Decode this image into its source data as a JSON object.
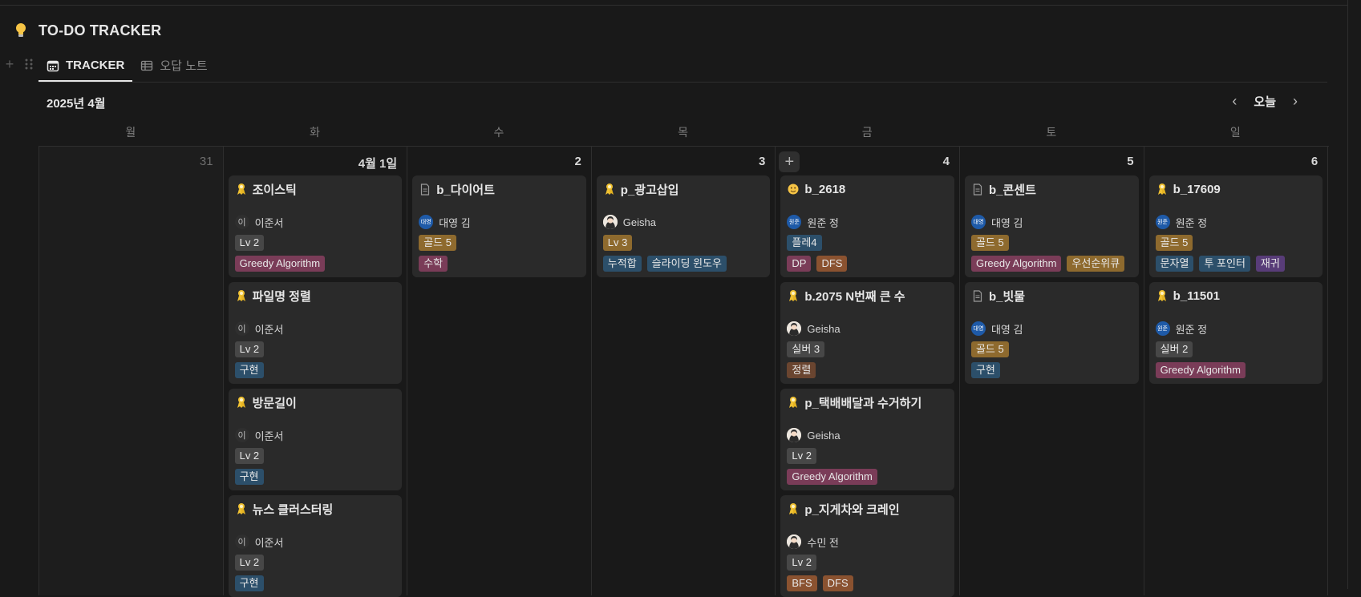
{
  "page": {
    "title": "TO-DO TRACKER",
    "icon": "lightbulb-icon"
  },
  "tabs": [
    {
      "label": "TRACKER",
      "icon": "calendar-icon",
      "active": true
    },
    {
      "label": "오답 노트",
      "icon": "table-icon",
      "active": false
    }
  ],
  "calendar": {
    "month_label": "2025년 4월",
    "today_label": "오늘",
    "weekdays": [
      "월",
      "화",
      "수",
      "목",
      "금",
      "토",
      "일"
    ],
    "days": [
      {
        "label": "31",
        "cards": []
      },
      {
        "label": "4월 1일",
        "cards": [
          {
            "icon": "ribbon",
            "title": "조이스틱",
            "person": {
              "name": "이준서",
              "avatar": "이",
              "style": "letter"
            },
            "rows": [
              [
                {
                  "text": "Lv 2",
                  "color": "gray"
                }
              ],
              [
                {
                  "text": "Greedy Algorithm",
                  "color": "pink"
                }
              ]
            ]
          },
          {
            "icon": "ribbon",
            "title": "파일명 정렬",
            "person": {
              "name": "이준서",
              "avatar": "이",
              "style": "letter"
            },
            "rows": [
              [
                {
                  "text": "Lv 2",
                  "color": "gray"
                }
              ],
              [
                {
                  "text": "구현",
                  "color": "blue"
                }
              ]
            ]
          },
          {
            "icon": "ribbon",
            "title": "방문길이",
            "person": {
              "name": "이준서",
              "avatar": "이",
              "style": "letter"
            },
            "rows": [
              [
                {
                  "text": "Lv 2",
                  "color": "gray"
                }
              ],
              [
                {
                  "text": "구현",
                  "color": "blue"
                }
              ]
            ]
          },
          {
            "icon": "ribbon",
            "title": "뉴스 클러스터링",
            "person": {
              "name": "이준서",
              "avatar": "이",
              "style": "letter"
            },
            "rows": [
              [
                {
                  "text": "Lv 2",
                  "color": "gray"
                }
              ],
              [
                {
                  "text": "구현",
                  "color": "blue"
                }
              ]
            ]
          }
        ]
      },
      {
        "label": "2",
        "cards": [
          {
            "icon": "doc",
            "title": "b_다이어트",
            "person": {
              "name": "대영 김",
              "avatar": "대영",
              "style": "blue"
            },
            "rows": [
              [
                {
                  "text": "골드 5",
                  "color": "gold"
                }
              ],
              [
                {
                  "text": "수학",
                  "color": "pink"
                }
              ]
            ]
          }
        ]
      },
      {
        "label": "3",
        "cards": [
          {
            "icon": "ribbon",
            "title": "p_광고삽입",
            "person": {
              "name": "Geisha",
              "avatar": "",
              "style": "img"
            },
            "rows": [
              [
                {
                  "text": "Lv 3",
                  "color": "gold"
                }
              ],
              [
                {
                  "text": "누적합",
                  "color": "blue"
                },
                {
                  "text": "슬라이딩 윈도우",
                  "color": "blue"
                }
              ]
            ]
          }
        ]
      },
      {
        "label": "4",
        "cards": [
          {
            "icon": "emoji",
            "title": "b_2618",
            "person": {
              "name": "원준 정",
              "avatar": "원준",
              "style": "blue"
            },
            "rows": [
              [
                {
                  "text": "플레4",
                  "color": "blue"
                }
              ],
              [
                {
                  "text": "DP",
                  "color": "pink"
                },
                {
                  "text": "DFS",
                  "color": "orange"
                }
              ]
            ]
          },
          {
            "icon": "ribbon",
            "title": "b.2075 N번째 큰 수",
            "person": {
              "name": "Geisha",
              "avatar": "",
              "style": "img"
            },
            "rows": [
              [
                {
                  "text": "실버 3",
                  "color": "gray"
                }
              ],
              [
                {
                  "text": "정렬",
                  "color": "brown"
                }
              ]
            ]
          },
          {
            "icon": "ribbon",
            "title": "p_택배배달과 수거하기",
            "person": {
              "name": "Geisha",
              "avatar": "",
              "style": "img"
            },
            "rows": [
              [
                {
                  "text": "Lv 2",
                  "color": "gray"
                }
              ],
              [
                {
                  "text": "Greedy Algorithm",
                  "color": "pink"
                }
              ]
            ]
          },
          {
            "icon": "ribbon",
            "title": "p_지게차와 크레인",
            "person": {
              "name": "수민 전",
              "avatar": "",
              "style": "img"
            },
            "rows": [
              [
                {
                  "text": "Lv 2",
                  "color": "gray"
                }
              ],
              [
                {
                  "text": "BFS",
                  "color": "orange"
                },
                {
                  "text": "DFS",
                  "color": "orange"
                }
              ]
            ]
          }
        ]
      },
      {
        "label": "5",
        "cards": [
          {
            "icon": "doc",
            "title": "b_콘센트",
            "person": {
              "name": "대영 김",
              "avatar": "대영",
              "style": "blue"
            },
            "rows": [
              [
                {
                  "text": "골드 5",
                  "color": "gold"
                }
              ],
              [
                {
                  "text": "Greedy Algorithm",
                  "color": "pink"
                },
                {
                  "text": "우선순위큐",
                  "color": "gold"
                }
              ]
            ]
          },
          {
            "icon": "doc",
            "title": "b_빗물",
            "person": {
              "name": "대영 김",
              "avatar": "대영",
              "style": "blue"
            },
            "rows": [
              [
                {
                  "text": "골드 5",
                  "color": "gold"
                }
              ],
              [
                {
                  "text": "구현",
                  "color": "blue"
                }
              ]
            ]
          }
        ]
      },
      {
        "label": "6",
        "cards": [
          {
            "icon": "ribbon",
            "title": "b_17609",
            "person": {
              "name": "원준 정",
              "avatar": "원준",
              "style": "blue"
            },
            "rows": [
              [
                {
                  "text": "골드 5",
                  "color": "gold"
                }
              ],
              [
                {
                  "text": "문자열",
                  "color": "blue"
                },
                {
                  "text": "투 포인터",
                  "color": "blue"
                },
                {
                  "text": "재귀",
                  "color": "purple"
                }
              ]
            ]
          },
          {
            "icon": "ribbon",
            "title": "b_11501",
            "person": {
              "name": "원준 정",
              "avatar": "원준",
              "style": "blue"
            },
            "rows": [
              [
                {
                  "text": "실버 2",
                  "color": "gray"
                }
              ],
              [
                {
                  "text": "Greedy Algorithm",
                  "color": "pink"
                }
              ]
            ]
          }
        ]
      }
    ]
  }
}
